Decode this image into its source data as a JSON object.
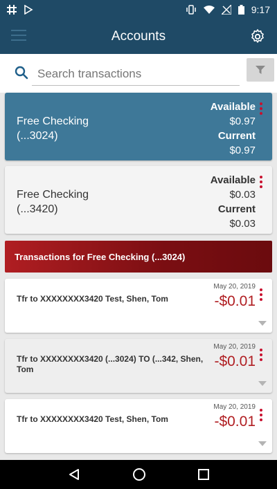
{
  "status": {
    "time": "9:17"
  },
  "header": {
    "title": "Accounts"
  },
  "search": {
    "placeholder": "Search transactions"
  },
  "accounts": [
    {
      "name": "Free Checking",
      "number": "(...3024)",
      "available_label": "Available",
      "available": "$0.97",
      "current_label": "Current",
      "current": "$0.97",
      "selected": true
    },
    {
      "name": "Free Checking",
      "number": "(...3420)",
      "available_label": "Available",
      "available": "$0.03",
      "current_label": "Current",
      "current": "$0.03",
      "selected": false
    }
  ],
  "transactions_header": "Transactions for Free Checking (...3024)",
  "transactions": [
    {
      "description": "Tfr to XXXXXXXX3420 Test, Shen, Tom",
      "date": "May 20, 2019",
      "amount": "-$0.01"
    },
    {
      "description": "Tfr to XXXXXXXX3420 (...3024) TO (...342, Shen, Tom",
      "date": "May 20, 2019",
      "amount": "-$0.01"
    },
    {
      "description": "Tfr to XXXXXXXX3420 Test, Shen, Tom",
      "date": "May 20, 2019",
      "amount": "-$0.01"
    }
  ],
  "colors": {
    "app_bar": "#1f4a66",
    "selected_account": "#3e7898",
    "accent_red": "#b01e22"
  }
}
